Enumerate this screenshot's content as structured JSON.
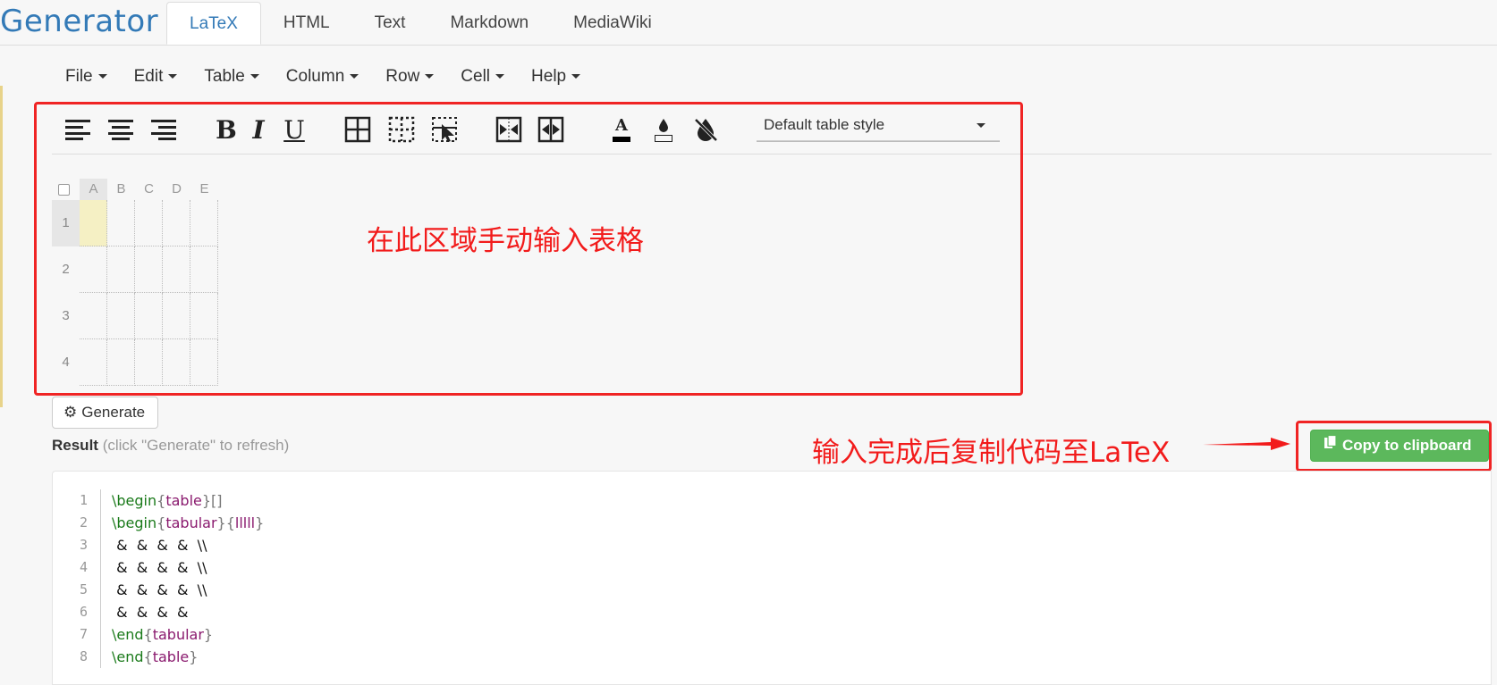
{
  "header": {
    "brand": "Generator",
    "tabs": [
      {
        "label": "LaTeX",
        "active": true
      },
      {
        "label": "HTML",
        "active": false
      },
      {
        "label": "Text",
        "active": false
      },
      {
        "label": "Markdown",
        "active": false
      },
      {
        "label": "MediaWiki",
        "active": false
      }
    ]
  },
  "menubar": {
    "items": [
      "File",
      "Edit",
      "Table",
      "Column",
      "Row",
      "Cell",
      "Help"
    ]
  },
  "toolbar": {
    "buttons": [
      "align-left-icon",
      "align-center-icon",
      "align-right-icon",
      "bold-icon",
      "italic-icon",
      "underline-icon",
      "all-borders-icon",
      "dashed-borders-icon",
      "select-borders-icon",
      "merge-cells-icon",
      "split-cells-icon",
      "text-color-icon",
      "fill-color-icon",
      "clear-formatting-icon"
    ],
    "bold_glyph": "B",
    "italic_glyph": "I",
    "underline_glyph": "U",
    "text_color_glyph": "A",
    "table_style": "Default table style"
  },
  "grid": {
    "columns": [
      "A",
      "B",
      "C",
      "D",
      "E"
    ],
    "rows": [
      "1",
      "2",
      "3",
      "4"
    ],
    "selected_cell": "A1"
  },
  "annotations": {
    "input_area": "在此区域手动输入表格",
    "copy_hint": "输入完成后复制代码至LaTeX",
    "color": "#f21b1b"
  },
  "actions": {
    "generate_label": "Generate",
    "copy_label": "Copy to clipboard"
  },
  "result": {
    "label": "Result",
    "hint": " (click \"Generate\" to refresh)"
  },
  "code": {
    "line_numbers": [
      "1",
      "2",
      "3",
      "4",
      "5",
      "6",
      "7",
      "8"
    ],
    "lines": [
      [
        [
          "kw",
          "\\begin"
        ],
        [
          "br",
          "{"
        ],
        [
          "arg",
          "table"
        ],
        [
          "br",
          "}[]"
        ]
      ],
      [
        [
          "kw",
          "\\begin"
        ],
        [
          "br",
          "{"
        ],
        [
          "arg",
          "tabular"
        ],
        [
          "br",
          "}{"
        ],
        [
          "arg",
          "lllll"
        ],
        [
          "br",
          "}"
        ]
      ],
      [
        [
          "txt",
          " &  &  &  &  \\\\"
        ]
      ],
      [
        [
          "txt",
          " &  &  &  &  \\\\"
        ]
      ],
      [
        [
          "txt",
          " &  &  &  &  \\\\"
        ]
      ],
      [
        [
          "txt",
          " &  &  &  & "
        ]
      ],
      [
        [
          "kw",
          "\\end"
        ],
        [
          "br",
          "{"
        ],
        [
          "arg",
          "tabular"
        ],
        [
          "br",
          "}"
        ]
      ],
      [
        [
          "kw",
          "\\end"
        ],
        [
          "br",
          "{"
        ],
        [
          "arg",
          "table"
        ],
        [
          "br",
          "}"
        ]
      ]
    ]
  },
  "colors": {
    "accent": "#337ab7",
    "success": "#5cb85c",
    "annotation_red": "#f02424",
    "selected_cell": "#f5f0c4"
  }
}
